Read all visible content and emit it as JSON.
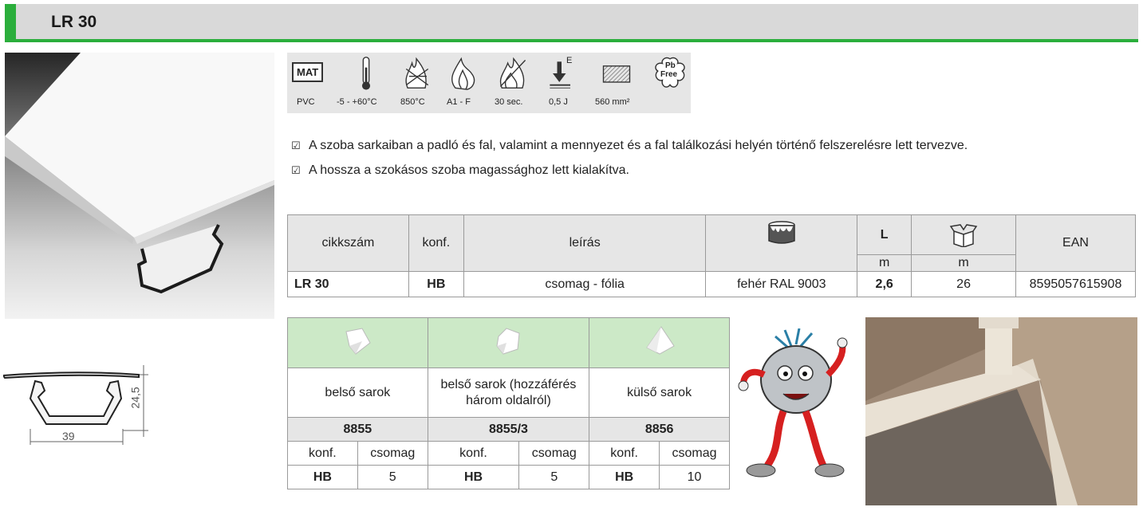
{
  "header": {
    "title": "LR 30"
  },
  "specs": [
    {
      "icon": "material-icon",
      "badge": "MAT",
      "label": "PVC"
    },
    {
      "icon": "thermometer-icon",
      "label": "-5 - +60°C"
    },
    {
      "icon": "glow-wire-icon",
      "label": "850°C"
    },
    {
      "icon": "flame-icon",
      "label": "A1 - F"
    },
    {
      "icon": "fire-duration-icon",
      "label": "30 sec."
    },
    {
      "icon": "impact-icon",
      "superscript": "E",
      "label": "0,5 J"
    },
    {
      "icon": "cross-section-icon",
      "label": "560 mm²"
    },
    {
      "icon": "pb-free-icon",
      "badge_line1": "Pb",
      "badge_line2": "Free"
    }
  ],
  "features": [
    "A szoba sarkaiban a padló és fal, valamint a mennyezet és a fal találkozási helyén történő felszerelésre lett tervezve.",
    "A hossza a szokásos szoba magassághoz lett kialakítva."
  ],
  "main_table": {
    "headers": {
      "code": "cikkszám",
      "conf": "konf.",
      "desc": "leírás",
      "color_icon": "paint-bucket-icon",
      "length": "L",
      "length_unit": "m",
      "box_icon": "box-icon",
      "box_unit": "m",
      "ean": "EAN"
    },
    "row": {
      "code": "LR 30",
      "conf": "HB",
      "desc": "csomag - fólia",
      "color": "fehér RAL 9003",
      "length": "2,6",
      "box": "26",
      "ean": "8595057615908"
    }
  },
  "corners": [
    {
      "icon": "inner-corner-icon",
      "name": "belső sarok",
      "code": "8855",
      "conf_label": "konf.",
      "pack_label": "csomag",
      "conf": "HB",
      "pack": "5"
    },
    {
      "icon": "inner-corner-open-icon",
      "name": "belső sarok (hozzáférés három oldalról)",
      "code": "8855/3",
      "conf_label": "konf.",
      "pack_label": "csomag",
      "conf": "HB",
      "pack": "5"
    },
    {
      "icon": "outer-corner-icon",
      "name": "külső sarok",
      "code": "8856",
      "conf_label": "konf.",
      "pack_label": "csomag",
      "conf": "HB",
      "pack": "10"
    }
  ],
  "drawing": {
    "width_label": "39",
    "height_label": "24,5"
  },
  "colors": {
    "accent": "#2bae3c",
    "header_bg": "#d9d9d9",
    "table_head_bg": "#e6e6e6",
    "corner_head_bg": "#cce9c7"
  }
}
